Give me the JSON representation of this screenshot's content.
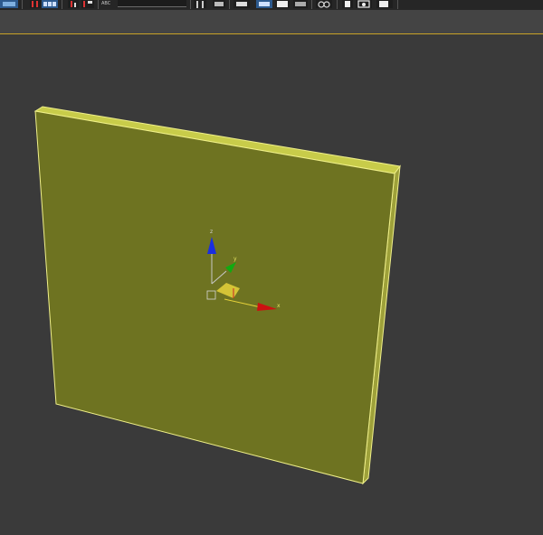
{
  "toolbar": {
    "text_field_label": "ABC",
    "tools": [
      {
        "name": "select-and-link-icon"
      },
      {
        "name": "unlink-icon"
      },
      {
        "name": "selection-filter-icon"
      },
      {
        "name": "align-icon"
      },
      {
        "name": "mirror-icon"
      },
      {
        "name": "layer-manager-icon"
      },
      {
        "name": "toggle-ribbon-icon"
      },
      {
        "name": "curve-editor-icon"
      },
      {
        "name": "schematic-view-icon"
      },
      {
        "name": "material-editor-icon"
      },
      {
        "name": "render-setup-icon"
      },
      {
        "name": "rendered-frame-icon"
      },
      {
        "name": "render-icon"
      }
    ]
  },
  "viewport": {
    "object": "box",
    "object_color": "#6e7321",
    "edge_color": "#e8e86a",
    "gizmo": {
      "x_label": "x",
      "y_label": "y",
      "z_label": "z",
      "x_color": "#cc1111",
      "y_color": "#11aa11",
      "z_color": "#1a2ee0"
    }
  }
}
